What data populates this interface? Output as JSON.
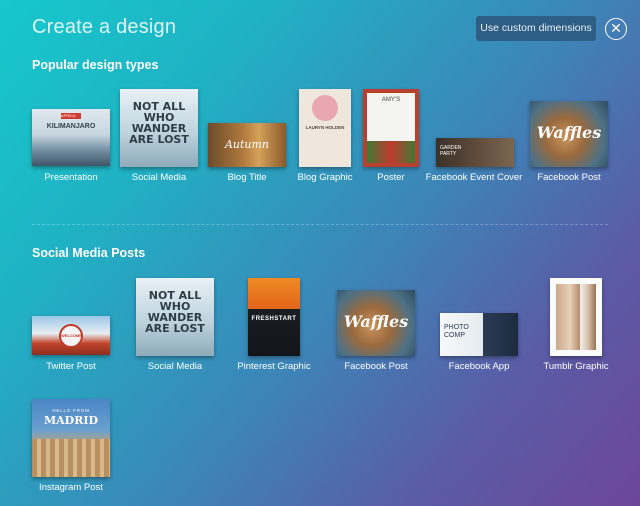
{
  "header": {
    "title": "Create a design",
    "custom_dimensions_label": "Use custom dimensions",
    "close_glyph": "✕"
  },
  "popular": {
    "heading": "Popular design types",
    "items": [
      {
        "label": "Presentation",
        "thumb_text": "KILIMANJARO",
        "tag": "AFRICA"
      },
      {
        "label": "Social Media",
        "thumb_text": "NOT ALL WHO WANDER ARE LOST"
      },
      {
        "label": "Blog Title",
        "thumb_text": "Autumn"
      },
      {
        "label": "Blog Graphic",
        "thumb_text": "LAURYN HOLDEN"
      },
      {
        "label": "Poster",
        "thumb_text": "AMY'S"
      },
      {
        "label": "Facebook Event Cover",
        "thumb_text": "GARDEN PARTY"
      },
      {
        "label": "Facebook Post",
        "thumb_text": "Waffles"
      }
    ]
  },
  "social": {
    "heading": "Social Media Posts",
    "items": [
      {
        "label": "Twitter Post",
        "thumb_text": "WELCOME"
      },
      {
        "label": "Social Media",
        "thumb_text": "NOT ALL WHO WANDER ARE LOST"
      },
      {
        "label": "Pinterest Graphic",
        "thumb_text": "FRESHSTART"
      },
      {
        "label": "Facebook Post",
        "thumb_text": "Waffles"
      },
      {
        "label": "Facebook App",
        "thumb_text": "PHOTO COMP"
      },
      {
        "label": "Tumblr Graphic",
        "thumb_text": ""
      },
      {
        "label": "Instagram Post",
        "thumb_text": "MADRID",
        "sub_text": "HELLO FROM"
      }
    ]
  },
  "colors": {
    "accent_button": "#2e5e83",
    "gradient_start": "#16c8cc",
    "gradient_end": "#6d4698"
  }
}
